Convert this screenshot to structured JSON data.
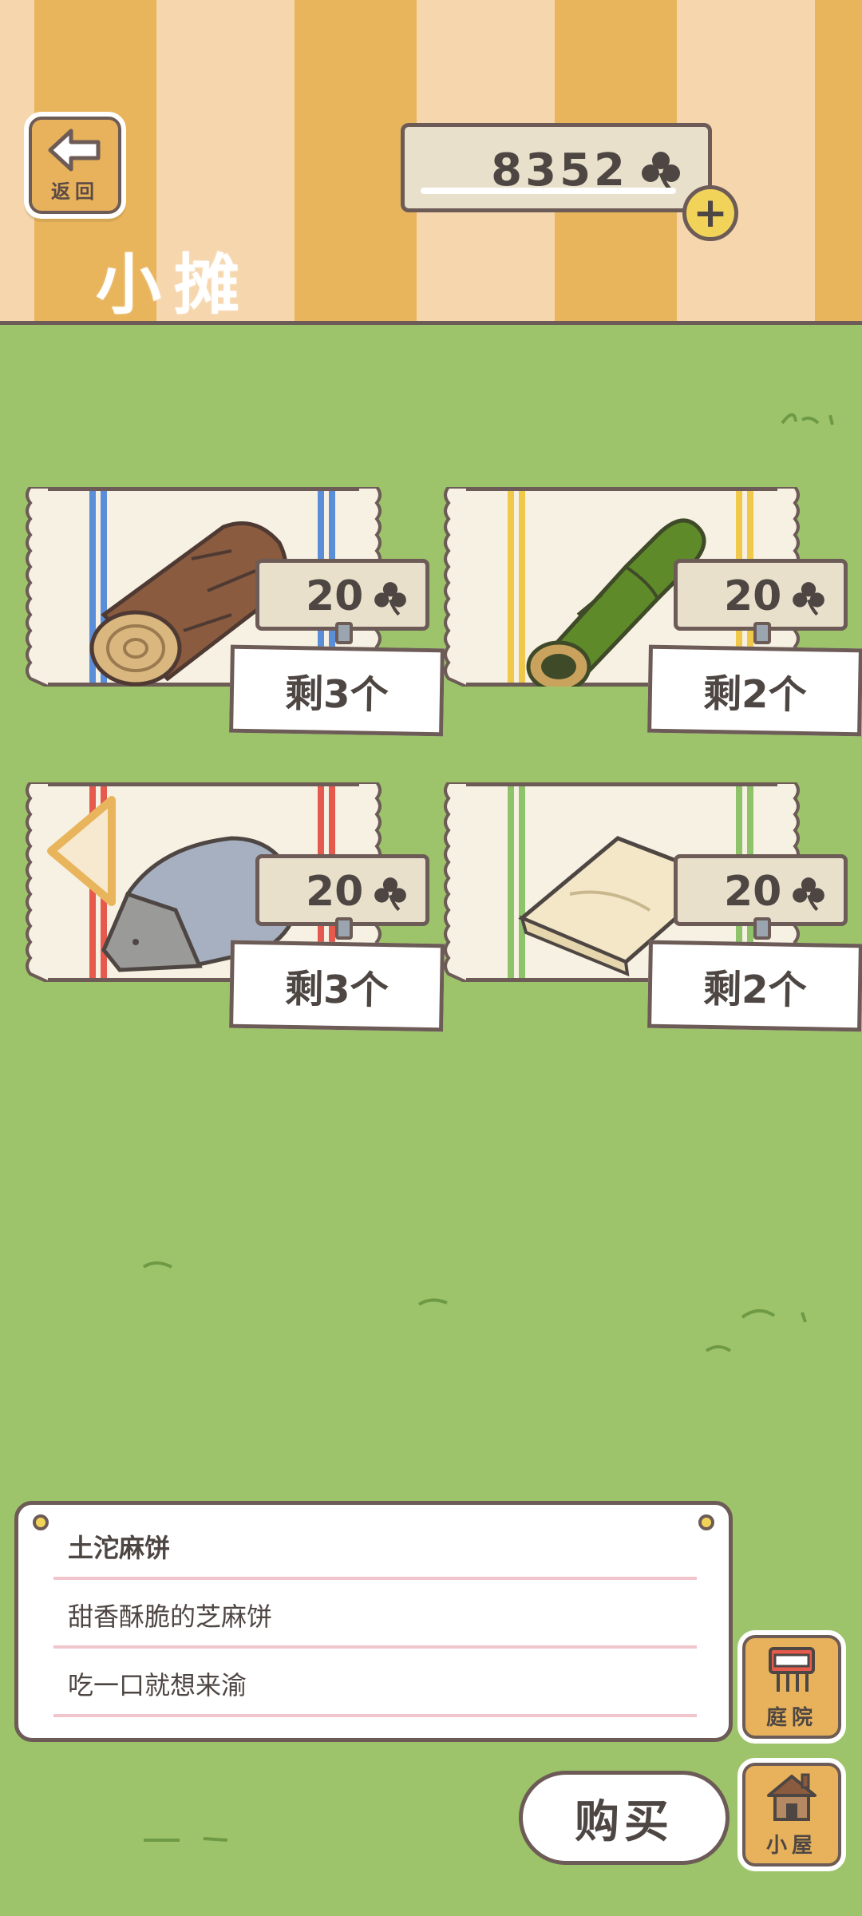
{
  "header": {
    "back_label": "返回",
    "title": "小摊",
    "currency_amount": "8352",
    "currency_icon": "clover-icon",
    "add_icon": "plus-icon"
  },
  "items": [
    {
      "name": "wood-log",
      "price": "20",
      "stock": "剩3个",
      "stripe_color": "#5b8ed9"
    },
    {
      "name": "bamboo",
      "price": "20",
      "stock": "剩2个",
      "stripe_color": "#f0c84a"
    },
    {
      "name": "stone",
      "price": "20",
      "stock": "剩3个",
      "stripe_color": "#e65a4d"
    },
    {
      "name": "cloth",
      "price": "20",
      "stock": "剩2个",
      "stripe_color": "#8fc36a"
    }
  ],
  "description": {
    "item_name": "土沱麻饼",
    "line1": "甜香酥脆的芝麻饼",
    "line2": "吃一口就想来渝"
  },
  "buttons": {
    "buy": "购买",
    "yard": "庭院",
    "house": "小屋"
  },
  "colors": {
    "grass": "#9dc46a",
    "outline": "#6c5b56",
    "stripe_orange": "#e8b55c",
    "stripe_cream": "#f6d6ad"
  }
}
